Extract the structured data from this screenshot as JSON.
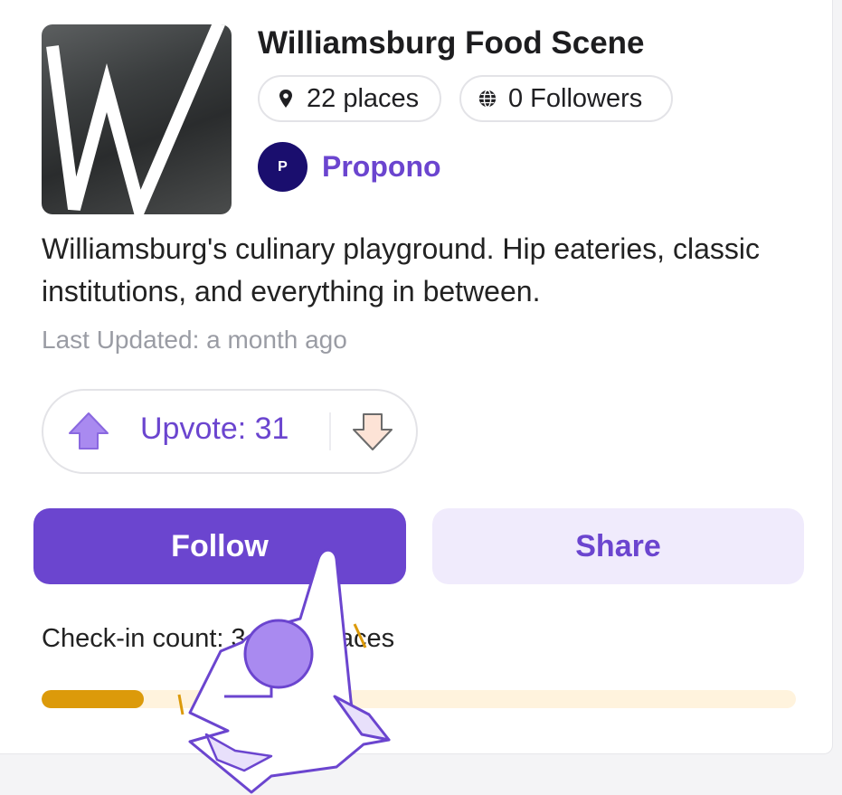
{
  "list": {
    "title": "Williamsburg Food Scene",
    "cover_letter": "W",
    "places_label": "22 places",
    "followers_label": "0 Followers",
    "description": "Williamsburg's culinary playground. Hip eateries, classic institutions, and everything in between.",
    "last_updated": "Last Updated: a month ago"
  },
  "owner": {
    "initial": "P",
    "name": "Propono"
  },
  "vote": {
    "upvote_label": "Upvote: 31"
  },
  "actions": {
    "follow_label": "Follow",
    "share_label": "Share"
  },
  "checkin": {
    "label": "Check-in count: 3 of 22 places",
    "progress_fraction": 0.136
  },
  "icons": {
    "places": "map-pin-icon",
    "followers": "globe-icon",
    "upvote": "arrow-up-icon",
    "downvote": "arrow-down-icon"
  },
  "colors": {
    "accent": "#6b45cf",
    "accent_light": "#f0ebfc",
    "avatar_bg": "#1a0e6e",
    "progress": "#dc9a0a",
    "progress_track": "#fff3dd",
    "muted_text": "#9a9ca4"
  }
}
